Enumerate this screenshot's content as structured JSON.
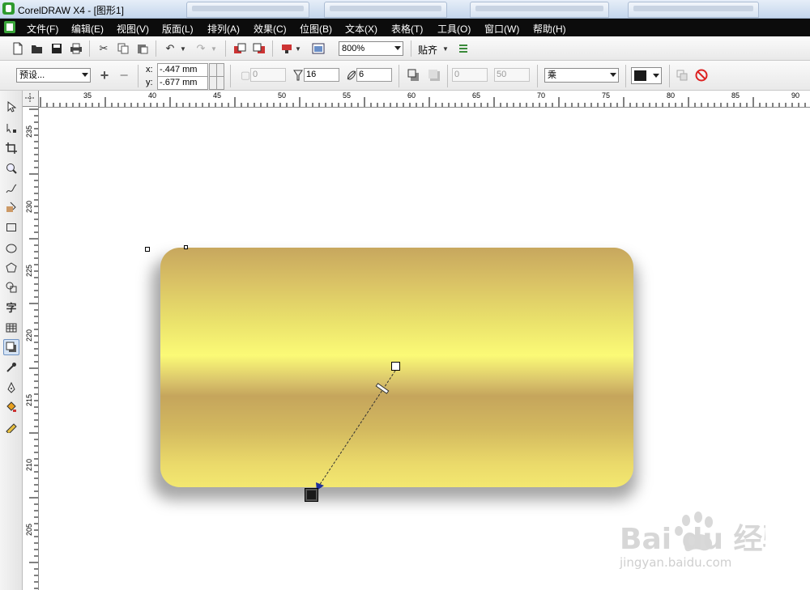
{
  "window": {
    "title": "CorelDRAW X4 - [图形1]"
  },
  "menu": [
    "文件(F)",
    "编辑(E)",
    "视图(V)",
    "版面(L)",
    "排列(A)",
    "效果(C)",
    "位图(B)",
    "文本(X)",
    "表格(T)",
    "工具(O)",
    "窗口(W)",
    "帮助(H)"
  ],
  "standard_toolbar": {
    "zoom": "800%",
    "snap_label": "贴齐"
  },
  "property_bar": {
    "preset": "预设...",
    "x_label": "x:",
    "x_value": "-.447 mm",
    "y_label": "y:",
    "y_value": "-.677 mm",
    "offset_value": "0",
    "opacity_value": "16",
    "feather_value": "6",
    "fade_value": "0",
    "stretch_value": "50",
    "merge_mode": "乘"
  },
  "ruler": {
    "h_labels": [
      "35",
      "40",
      "45",
      "50",
      "55",
      "60",
      "65",
      "70",
      "75",
      "80",
      "85",
      "90"
    ],
    "v_labels": [
      "235",
      "230",
      "225",
      "220",
      "215",
      "210",
      "205"
    ]
  },
  "watermark": {
    "logo": "Bai du 经验",
    "url": "jingyan.baidu.com"
  },
  "colors": {
    "menubar": "#0c0c0c",
    "gold_light": "#fbfa76",
    "gold_dark": "#c5a55c",
    "vector_arrow": "#1f2f9c"
  }
}
